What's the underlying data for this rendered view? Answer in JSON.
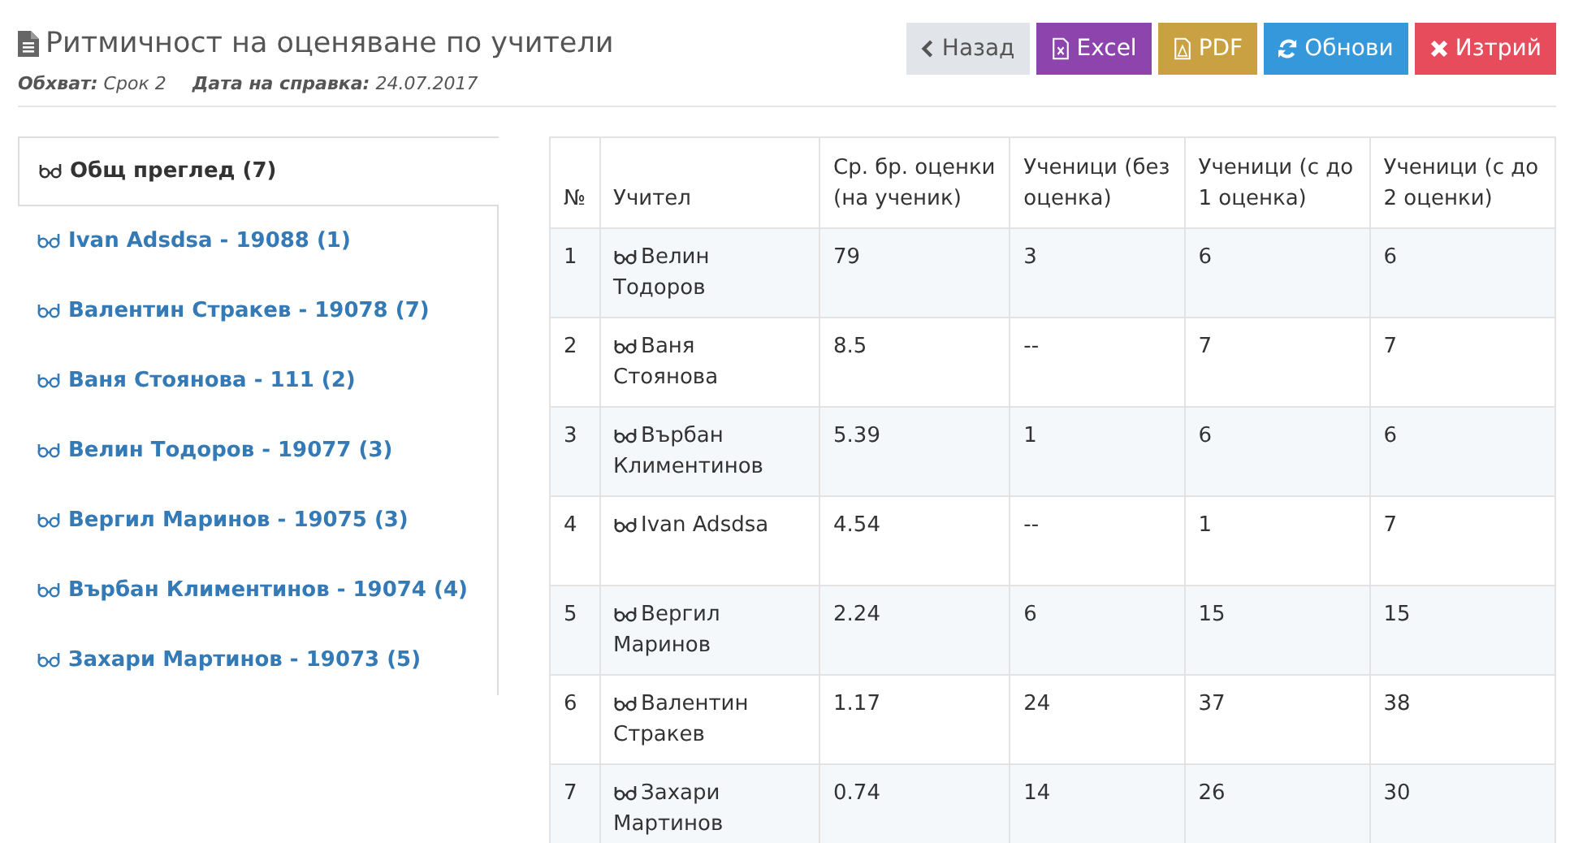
{
  "header": {
    "title": "Ритмичност на оценяване по учители",
    "meta": [
      {
        "label": "Обхват:",
        "value": "Срок 2"
      },
      {
        "label": "Дата на справка:",
        "value": "24.07.2017"
      }
    ]
  },
  "buttons": [
    {
      "kind": "back",
      "label": "Назад"
    },
    {
      "kind": "excel",
      "label": "Excel"
    },
    {
      "kind": "pdf",
      "label": "PDF"
    },
    {
      "kind": "refresh",
      "label": "Обнови"
    },
    {
      "kind": "delete",
      "label": "Изтрий"
    }
  ],
  "sidebar": {
    "items": [
      {
        "label": "Общ преглед (7)",
        "selected": true
      },
      {
        "label": "Ivan Adsdsa - 19088 (1)",
        "selected": false
      },
      {
        "label": "Валентин Стракев - 19078 (7)",
        "selected": false
      },
      {
        "label": "Ваня Стоянова - 111 (2)",
        "selected": false
      },
      {
        "label": "Велин Тодоров - 19077 (3)",
        "selected": false
      },
      {
        "label": "Вергил Маринов - 19075 (3)",
        "selected": false
      },
      {
        "label": "Върбан Климентинов - 19074 (4)",
        "selected": false
      },
      {
        "label": "Захари Мартинов - 19073 (5)",
        "selected": false
      }
    ]
  },
  "table": {
    "columns": [
      "№",
      "Учител",
      "Ср. бр. оценки (на ученик)",
      "Ученици (без оценка)",
      "Ученици (с до 1 оценка)",
      "Ученици (с до 2 оценки)"
    ],
    "rows": [
      [
        "1",
        "Велин Тодоров",
        "79",
        "3",
        "6",
        "6"
      ],
      [
        "2",
        "Ваня Стоянова",
        "8.5",
        "--",
        "7",
        "7"
      ],
      [
        "3",
        "Върбан Климентинов",
        "5.39",
        "1",
        "6",
        "6"
      ],
      [
        "4",
        "Ivan Adsdsa",
        "4.54",
        "--",
        "1",
        "7"
      ],
      [
        "5",
        "Вергил Маринов",
        "2.24",
        "6",
        "15",
        "15"
      ],
      [
        "6",
        "Валентин Стракев",
        "1.17",
        "24",
        "37",
        "38"
      ],
      [
        "7",
        "Захари Мартинов",
        "0.74",
        "14",
        "26",
        "30"
      ]
    ]
  }
}
